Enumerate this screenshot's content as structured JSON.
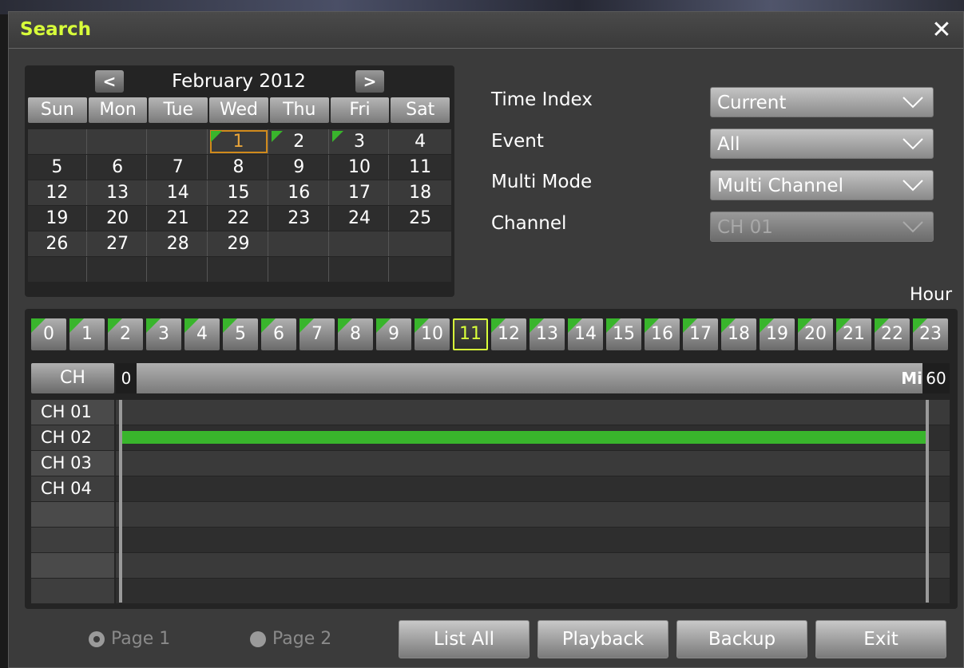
{
  "window": {
    "title": "Search",
    "close_icon": "close-icon"
  },
  "calendar": {
    "prev_label": "<",
    "next_label": ">",
    "month_label": "February 2012",
    "weekdays": [
      "Sun",
      "Mon",
      "Tue",
      "Wed",
      "Thu",
      "Fri",
      "Sat"
    ],
    "weeks": [
      [
        "",
        "",
        "",
        "1",
        "2",
        "3",
        "4"
      ],
      [
        "5",
        "6",
        "7",
        "8",
        "9",
        "10",
        "11"
      ],
      [
        "12",
        "13",
        "14",
        "15",
        "16",
        "17",
        "18"
      ],
      [
        "19",
        "20",
        "21",
        "22",
        "23",
        "24",
        "25"
      ],
      [
        "26",
        "27",
        "28",
        "29",
        "",
        "",
        ""
      ],
      [
        "",
        "",
        "",
        "",
        "",
        "",
        ""
      ]
    ],
    "selected_day": "1",
    "recorded_days": [
      "1",
      "2",
      "3"
    ]
  },
  "options": {
    "time_index": {
      "label": "Time Index",
      "value": "Current"
    },
    "event": {
      "label": "Event",
      "value": "All"
    },
    "multi_mode": {
      "label": "Multi Mode",
      "value": "Multi Channel"
    },
    "channel": {
      "label": "Channel",
      "value": "CH 01"
    }
  },
  "timeline": {
    "hour_label": "Hour",
    "hours": [
      "0",
      "1",
      "2",
      "3",
      "4",
      "5",
      "6",
      "7",
      "8",
      "9",
      "10",
      "11",
      "12",
      "13",
      "14",
      "15",
      "16",
      "17",
      "18",
      "19",
      "20",
      "21",
      "22",
      "23"
    ],
    "selected_hour": "11",
    "ch_header": "CH",
    "min_start": "0",
    "min_label": "Mi",
    "min_end": "60",
    "channels": [
      "CH 01",
      "CH 02",
      "CH 03",
      "CH 04",
      "",
      "",
      "",
      ""
    ],
    "recordings": [
      {
        "channel": "CH 02",
        "start_min": 0,
        "end_min": 60
      }
    ]
  },
  "pages": {
    "page1": "Page 1",
    "page2": "Page 2",
    "selected": "Page 1"
  },
  "buttons": {
    "list_all": "List All",
    "playback": "Playback",
    "backup": "Backup",
    "exit": "Exit"
  },
  "colors": {
    "title": "#d8ff3a",
    "recorded": "#39b52c",
    "selected_day": "#d08a1c"
  }
}
